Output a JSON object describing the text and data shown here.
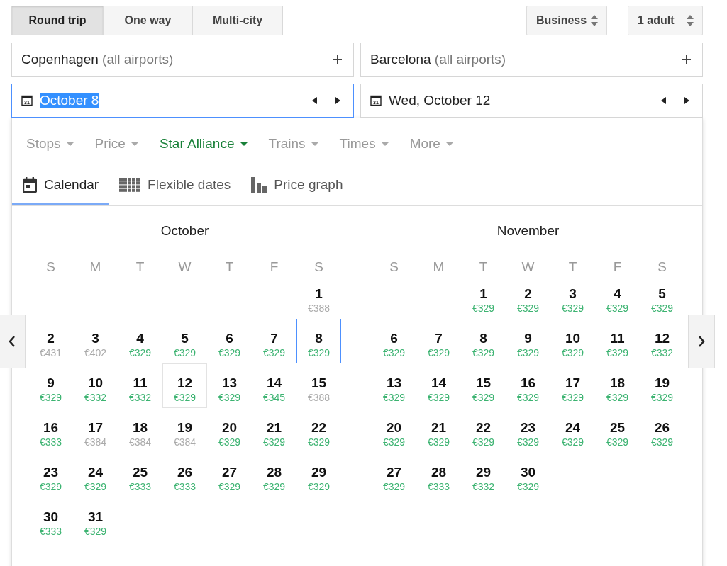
{
  "trip_types": [
    {
      "label": "Round trip",
      "selected": true
    },
    {
      "label": "One way",
      "selected": false
    },
    {
      "label": "Multi-city",
      "selected": false
    }
  ],
  "cabin": {
    "value": "Business"
  },
  "passengers": {
    "value": "1 adult"
  },
  "origin": {
    "city": "Copenhagen",
    "qualifier": "(all airports)"
  },
  "destination": {
    "city": "Barcelona",
    "qualifier": "(all airports)"
  },
  "departure_date": {
    "icon_text": "31",
    "value": "October 8",
    "focused": true,
    "text_selected": true
  },
  "return_date": {
    "icon_text": "31",
    "value": "Wed, October 12",
    "focused": false,
    "text_selected": false
  },
  "filters": [
    {
      "label": "Stops",
      "active": false
    },
    {
      "label": "Price",
      "active": false
    },
    {
      "label": "Star Alliance",
      "active": true
    },
    {
      "label": "Trains",
      "active": false
    },
    {
      "label": "Times",
      "active": false
    },
    {
      "label": "More",
      "active": false
    }
  ],
  "tabs": [
    {
      "label": "Calendar",
      "kind": "calendar",
      "selected": true
    },
    {
      "label": "Flexible dates",
      "kind": "grid",
      "selected": false
    },
    {
      "label": "Price graph",
      "kind": "bars",
      "selected": false
    }
  ],
  "months": [
    {
      "name": "October",
      "weekdays": [
        "S",
        "M",
        "T",
        "W",
        "T",
        "F",
        "S"
      ],
      "weeks": [
        [
          {
            "kind": "blank"
          },
          {
            "kind": "blank"
          },
          {
            "kind": "blank"
          },
          {
            "kind": "blank"
          },
          {
            "kind": "blank"
          },
          {
            "kind": "blank"
          },
          {
            "day": "1",
            "price": "€388",
            "cheap": false,
            "selected": false,
            "return": false
          }
        ],
        [
          {
            "day": "2",
            "price": "€431",
            "cheap": false,
            "selected": false,
            "return": false
          },
          {
            "day": "3",
            "price": "€402",
            "cheap": false,
            "selected": false,
            "return": false
          },
          {
            "day": "4",
            "price": "€329",
            "cheap": true,
            "selected": false,
            "return": false
          },
          {
            "day": "5",
            "price": "€329",
            "cheap": true,
            "selected": false,
            "return": false
          },
          {
            "day": "6",
            "price": "€329",
            "cheap": true,
            "selected": false,
            "return": false
          },
          {
            "day": "7",
            "price": "€329",
            "cheap": true,
            "selected": false,
            "return": false
          },
          {
            "day": "8",
            "price": "€329",
            "cheap": true,
            "selected": true,
            "return": false
          }
        ],
        [
          {
            "day": "9",
            "price": "€329",
            "cheap": true,
            "selected": false,
            "return": false
          },
          {
            "day": "10",
            "price": "€332",
            "cheap": true,
            "selected": false,
            "return": false
          },
          {
            "day": "11",
            "price": "€332",
            "cheap": true,
            "selected": false,
            "return": false
          },
          {
            "day": "12",
            "price": "€329",
            "cheap": true,
            "selected": false,
            "return": true
          },
          {
            "day": "13",
            "price": "€329",
            "cheap": true,
            "selected": false,
            "return": false
          },
          {
            "day": "14",
            "price": "€345",
            "cheap": true,
            "selected": false,
            "return": false
          },
          {
            "day": "15",
            "price": "€388",
            "cheap": false,
            "selected": false,
            "return": false
          }
        ],
        [
          {
            "day": "16",
            "price": "€333",
            "cheap": true,
            "selected": false,
            "return": false
          },
          {
            "day": "17",
            "price": "€384",
            "cheap": false,
            "selected": false,
            "return": false
          },
          {
            "day": "18",
            "price": "€384",
            "cheap": false,
            "selected": false,
            "return": false
          },
          {
            "day": "19",
            "price": "€384",
            "cheap": false,
            "selected": false,
            "return": false
          },
          {
            "day": "20",
            "price": "€329",
            "cheap": true,
            "selected": false,
            "return": false
          },
          {
            "day": "21",
            "price": "€329",
            "cheap": true,
            "selected": false,
            "return": false
          },
          {
            "day": "22",
            "price": "€329",
            "cheap": true,
            "selected": false,
            "return": false
          }
        ],
        [
          {
            "day": "23",
            "price": "€329",
            "cheap": true,
            "selected": false,
            "return": false
          },
          {
            "day": "24",
            "price": "€329",
            "cheap": true,
            "selected": false,
            "return": false
          },
          {
            "day": "25",
            "price": "€333",
            "cheap": true,
            "selected": false,
            "return": false
          },
          {
            "day": "26",
            "price": "€333",
            "cheap": true,
            "selected": false,
            "return": false
          },
          {
            "day": "27",
            "price": "€329",
            "cheap": true,
            "selected": false,
            "return": false
          },
          {
            "day": "28",
            "price": "€329",
            "cheap": true,
            "selected": false,
            "return": false
          },
          {
            "day": "29",
            "price": "€329",
            "cheap": true,
            "selected": false,
            "return": false
          }
        ],
        [
          {
            "day": "30",
            "price": "€333",
            "cheap": true,
            "selected": false,
            "return": false
          },
          {
            "day": "31",
            "price": "€329",
            "cheap": true,
            "selected": false,
            "return": false
          },
          {
            "kind": "blank"
          },
          {
            "kind": "blank"
          },
          {
            "kind": "blank"
          },
          {
            "kind": "blank"
          },
          {
            "kind": "blank"
          }
        ]
      ]
    },
    {
      "name": "November",
      "weekdays": [
        "S",
        "M",
        "T",
        "W",
        "T",
        "F",
        "S"
      ],
      "weeks": [
        [
          {
            "kind": "blank"
          },
          {
            "kind": "blank"
          },
          {
            "day": "1",
            "price": "€329",
            "cheap": true,
            "selected": false,
            "return": false
          },
          {
            "day": "2",
            "price": "€329",
            "cheap": true,
            "selected": false,
            "return": false
          },
          {
            "day": "3",
            "price": "€329",
            "cheap": true,
            "selected": false,
            "return": false
          },
          {
            "day": "4",
            "price": "€329",
            "cheap": true,
            "selected": false,
            "return": false
          },
          {
            "day": "5",
            "price": "€329",
            "cheap": true,
            "selected": false,
            "return": false
          }
        ],
        [
          {
            "day": "6",
            "price": "€329",
            "cheap": true,
            "selected": false,
            "return": false
          },
          {
            "day": "7",
            "price": "€329",
            "cheap": true,
            "selected": false,
            "return": false
          },
          {
            "day": "8",
            "price": "€329",
            "cheap": true,
            "selected": false,
            "return": false
          },
          {
            "day": "9",
            "price": "€329",
            "cheap": true,
            "selected": false,
            "return": false
          },
          {
            "day": "10",
            "price": "€329",
            "cheap": true,
            "selected": false,
            "return": false
          },
          {
            "day": "11",
            "price": "€329",
            "cheap": true,
            "selected": false,
            "return": false
          },
          {
            "day": "12",
            "price": "€332",
            "cheap": true,
            "selected": false,
            "return": false
          }
        ],
        [
          {
            "day": "13",
            "price": "€329",
            "cheap": true,
            "selected": false,
            "return": false
          },
          {
            "day": "14",
            "price": "€329",
            "cheap": true,
            "selected": false,
            "return": false
          },
          {
            "day": "15",
            "price": "€329",
            "cheap": true,
            "selected": false,
            "return": false
          },
          {
            "day": "16",
            "price": "€329",
            "cheap": true,
            "selected": false,
            "return": false
          },
          {
            "day": "17",
            "price": "€329",
            "cheap": true,
            "selected": false,
            "return": false
          },
          {
            "day": "18",
            "price": "€329",
            "cheap": true,
            "selected": false,
            "return": false
          },
          {
            "day": "19",
            "price": "€329",
            "cheap": true,
            "selected": false,
            "return": false
          }
        ],
        [
          {
            "day": "20",
            "price": "€329",
            "cheap": true,
            "selected": false,
            "return": false
          },
          {
            "day": "21",
            "price": "€329",
            "cheap": true,
            "selected": false,
            "return": false
          },
          {
            "day": "22",
            "price": "€329",
            "cheap": true,
            "selected": false,
            "return": false
          },
          {
            "day": "23",
            "price": "€329",
            "cheap": true,
            "selected": false,
            "return": false
          },
          {
            "day": "24",
            "price": "€329",
            "cheap": true,
            "selected": false,
            "return": false
          },
          {
            "day": "25",
            "price": "€329",
            "cheap": true,
            "selected": false,
            "return": false
          },
          {
            "day": "26",
            "price": "€329",
            "cheap": true,
            "selected": false,
            "return": false
          }
        ],
        [
          {
            "day": "27",
            "price": "€329",
            "cheap": true,
            "selected": false,
            "return": false
          },
          {
            "day": "28",
            "price": "€333",
            "cheap": true,
            "selected": false,
            "return": false
          },
          {
            "day": "29",
            "price": "€332",
            "cheap": true,
            "selected": false,
            "return": false
          },
          {
            "day": "30",
            "price": "€329",
            "cheap": true,
            "selected": false,
            "return": false
          },
          {
            "kind": "blank"
          },
          {
            "kind": "blank"
          },
          {
            "kind": "blank"
          }
        ]
      ]
    }
  ]
}
